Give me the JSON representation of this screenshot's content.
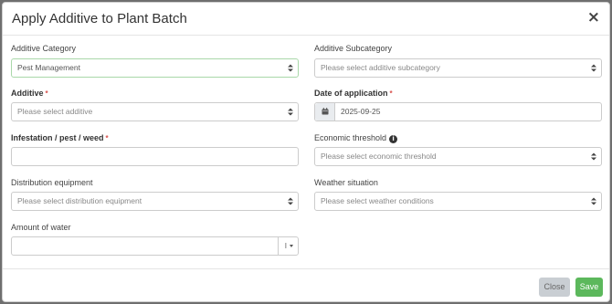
{
  "modal": {
    "title": "Apply Additive to Plant Batch",
    "close_symbol": "×"
  },
  "form": {
    "additive_category": {
      "label": "Additive Category",
      "value": "Pest Management"
    },
    "additive_subcategory": {
      "label": "Additive Subcategory",
      "placeholder": "Please select additive subcategory"
    },
    "additive": {
      "label": "Additive",
      "required": "*",
      "placeholder": "Please select additive"
    },
    "date_of_application": {
      "label": "Date of application",
      "required": "*",
      "value": "2025-09-25",
      "icon": "calendar-icon"
    },
    "infestation": {
      "label": "Infestation / pest / weed",
      "required": "*",
      "value": ""
    },
    "economic_threshold": {
      "label": "Economic threshold",
      "info_icon": "i",
      "placeholder": "Please select economic threshold"
    },
    "distribution_equipment": {
      "label": "Distribution equipment",
      "placeholder": "Please select distribution equipment"
    },
    "weather_situation": {
      "label": "Weather situation",
      "placeholder": "Please select weather conditions"
    },
    "amount_of_water": {
      "label": "Amount of water",
      "value": "",
      "unit": "l"
    }
  },
  "footer": {
    "close_label": "Close",
    "save_label": "Save"
  },
  "colors": {
    "save": "#5cb85c",
    "close": "#c9ced3",
    "required": "#d9534f",
    "selected_border": "#a9d8a9"
  }
}
